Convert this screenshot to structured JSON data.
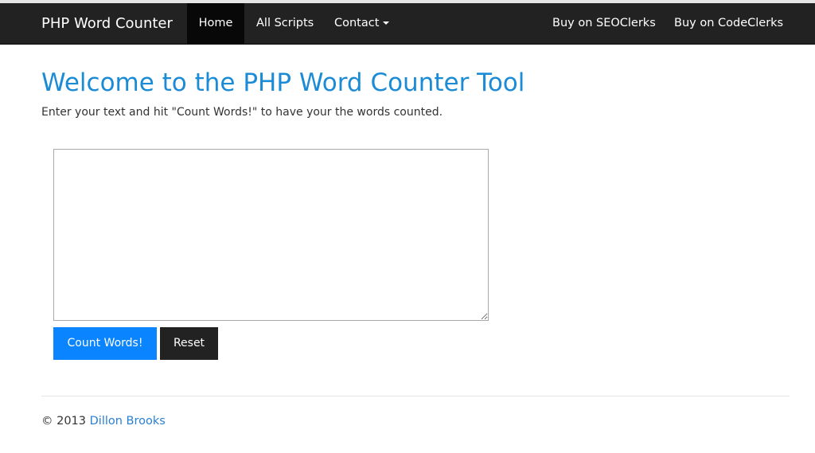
{
  "navbar": {
    "brand": "PHP Word Counter",
    "items": [
      {
        "label": "Home",
        "active": true
      },
      {
        "label": "All Scripts",
        "active": false
      },
      {
        "label": "Contact",
        "active": false,
        "dropdown": true
      }
    ],
    "right_items": [
      {
        "label": "Buy on SEOClerks"
      },
      {
        "label": "Buy on CodeClerks"
      }
    ],
    "caret_icon": "caret-down-icon"
  },
  "main": {
    "title": "Welcome to the PHP Word Counter Tool",
    "lead": "Enter your text and hit \"Count Words!\" to have your the words counted.",
    "textarea_value": "",
    "count_button_label": "Count Words!",
    "reset_button_label": "Reset"
  },
  "footer": {
    "copyright": "© 2013",
    "author": "Dillon Brooks"
  },
  "colors": {
    "navbar_bg": "#222222",
    "navbar_active_bg": "#080808",
    "title": "#1b8bd6",
    "primary_button": "#0a84ff",
    "dark_button": "#222222",
    "link": "#2a7fd4"
  }
}
